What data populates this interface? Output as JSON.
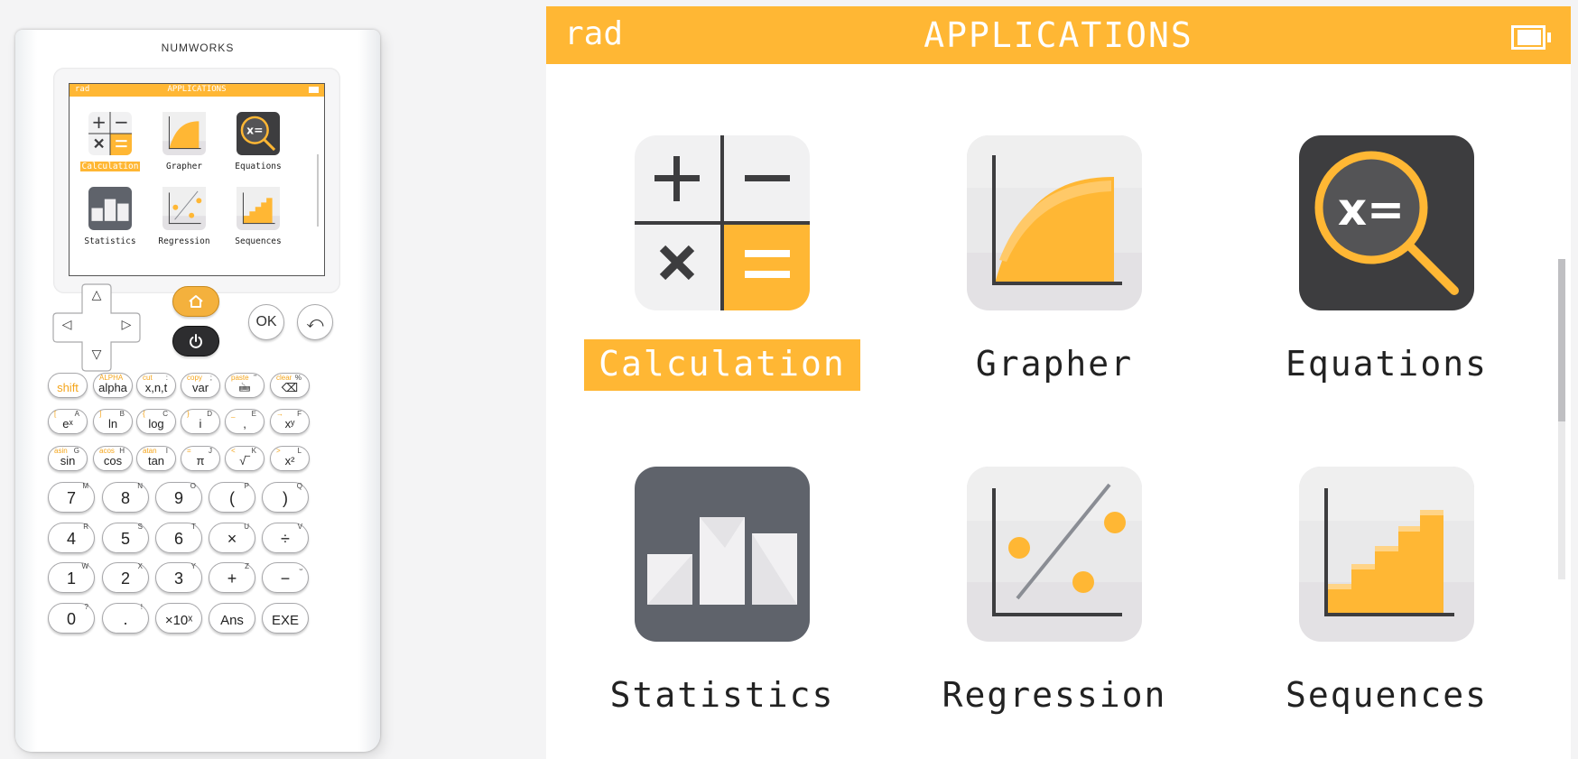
{
  "device": {
    "brand": "NUMWORKS",
    "mini_screen": {
      "mode": "rad",
      "title": "APPLICATIONS",
      "apps": [
        {
          "label": "Calculation",
          "selected": true
        },
        {
          "label": "Grapher",
          "selected": false
        },
        {
          "label": "Equations",
          "selected": false
        },
        {
          "label": "Statistics",
          "selected": false
        },
        {
          "label": "Regression",
          "selected": false
        },
        {
          "label": "Sequences",
          "selected": false
        }
      ]
    },
    "nav": {
      "up": "△",
      "down": "▽",
      "left": "◁",
      "right": "▷",
      "home_icon": "home-icon",
      "power_icon": "power-icon",
      "ok": "OK",
      "back": "⤺"
    },
    "function_rows": [
      [
        {
          "main": "shift",
          "tl": "",
          "tr": ""
        },
        {
          "main": "alpha",
          "tl": "ALPHA",
          "tr": ""
        },
        {
          "main": "x,n,t",
          "tl": "cut",
          "tr": ":"
        },
        {
          "main": "var",
          "tl": "copy",
          "tr": ";"
        },
        {
          "main": "🖮",
          "tl": "paste",
          "tr": "\""
        },
        {
          "main": "⌫",
          "tl": "clear",
          "tr": "%"
        }
      ],
      [
        {
          "main": "eˣ",
          "tl": "[",
          "tr": "A"
        },
        {
          "main": "ln",
          "tl": "]",
          "tr": "B"
        },
        {
          "main": "log",
          "tl": "{",
          "tr": "C"
        },
        {
          "main": "i",
          "tl": "}",
          "tr": "D"
        },
        {
          "main": ",",
          "tl": "_",
          "tr": "E"
        },
        {
          "main": "xʸ",
          "tl": "→",
          "tr": "F"
        }
      ],
      [
        {
          "main": "sin",
          "tl": "asin",
          "tr": "G"
        },
        {
          "main": "cos",
          "tl": "acos",
          "tr": "H"
        },
        {
          "main": "tan",
          "tl": "atan",
          "tr": "I"
        },
        {
          "main": "π",
          "tl": "=",
          "tr": "J"
        },
        {
          "main": "√‾",
          "tl": "<",
          "tr": "K"
        },
        {
          "main": "x²",
          "tl": ">",
          "tr": "L"
        }
      ]
    ],
    "number_rows": [
      [
        {
          "main": "7",
          "tr": "M"
        },
        {
          "main": "8",
          "tr": "N"
        },
        {
          "main": "9",
          "tr": "O"
        },
        {
          "main": "(",
          "tr": "P"
        },
        {
          "main": ")",
          "tr": "Q"
        }
      ],
      [
        {
          "main": "4",
          "tr": "R"
        },
        {
          "main": "5",
          "tr": "S"
        },
        {
          "main": "6",
          "tr": "T"
        },
        {
          "main": "×",
          "tr": "U"
        },
        {
          "main": "÷",
          "tr": "V"
        }
      ],
      [
        {
          "main": "1",
          "tr": "W"
        },
        {
          "main": "2",
          "tr": "X"
        },
        {
          "main": "3",
          "tr": "Y"
        },
        {
          "main": "+",
          "tr": "Z"
        },
        {
          "main": "−",
          "tr": "⎵"
        }
      ],
      [
        {
          "main": "0",
          "tr": "?"
        },
        {
          "main": ".",
          "tr": "!"
        },
        {
          "main": "×10ˣ",
          "tr": ""
        },
        {
          "main": "Ans",
          "tr": ""
        },
        {
          "main": "EXE",
          "tr": ""
        }
      ]
    ]
  },
  "screen": {
    "mode": "rad",
    "title": "APPLICATIONS",
    "battery_icon": "battery-icon",
    "apps": [
      {
        "label": "Calculation",
        "icon": "calculation-icon",
        "selected": true
      },
      {
        "label": "Grapher",
        "icon": "grapher-icon",
        "selected": false
      },
      {
        "label": "Equations",
        "icon": "equations-icon",
        "selected": false
      },
      {
        "label": "Statistics",
        "icon": "statistics-icon",
        "selected": false
      },
      {
        "label": "Regression",
        "icon": "regression-icon",
        "selected": false
      },
      {
        "label": "Sequences",
        "icon": "sequences-icon",
        "selected": false
      }
    ],
    "colors": {
      "accent": "#ffb734",
      "dark": "#3d3d3f",
      "stats_bg": "#5f636b"
    }
  }
}
